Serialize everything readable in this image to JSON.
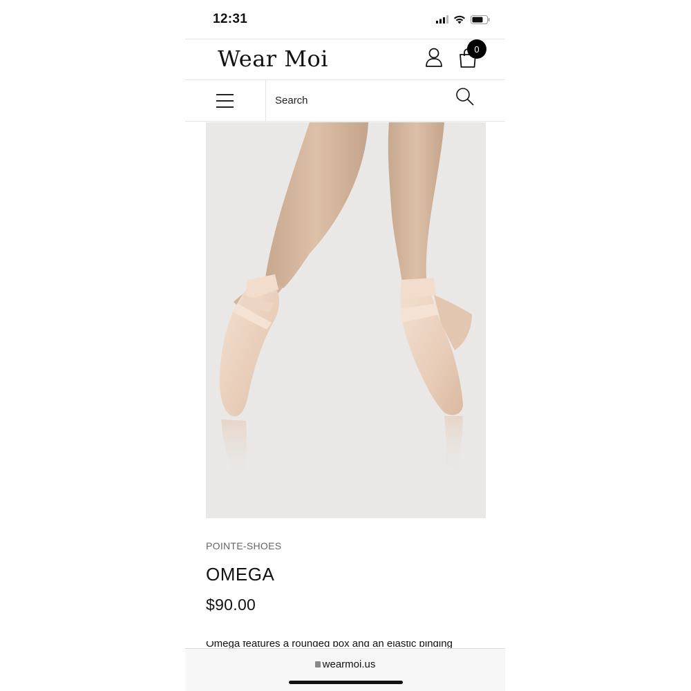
{
  "status_bar": {
    "time": "12:31",
    "icons": [
      "signal-icon",
      "wifi-icon",
      "battery-icon"
    ]
  },
  "header": {
    "logo_text": "Wear Moi",
    "account_icon": "user-icon",
    "cart_icon": "shopping-bag-icon",
    "cart_count": "0"
  },
  "search": {
    "menu_icon": "hamburger-menu-icon",
    "placeholder": "Search",
    "search_icon": "search-icon"
  },
  "product": {
    "image": "pointe-shoes-photo",
    "category": "POINTE-SHOES",
    "name": "OMEGA",
    "price": "$90.00",
    "description_partial": "Omega features a rounded box and an elastic binding"
  },
  "browser": {
    "url": "wearmoi.us"
  },
  "colors": {
    "text": "#111111",
    "muted": "#666666",
    "badge": "#000000",
    "image_bg": "#e8e7e6",
    "shoe_satin": "#ecd3c0"
  }
}
